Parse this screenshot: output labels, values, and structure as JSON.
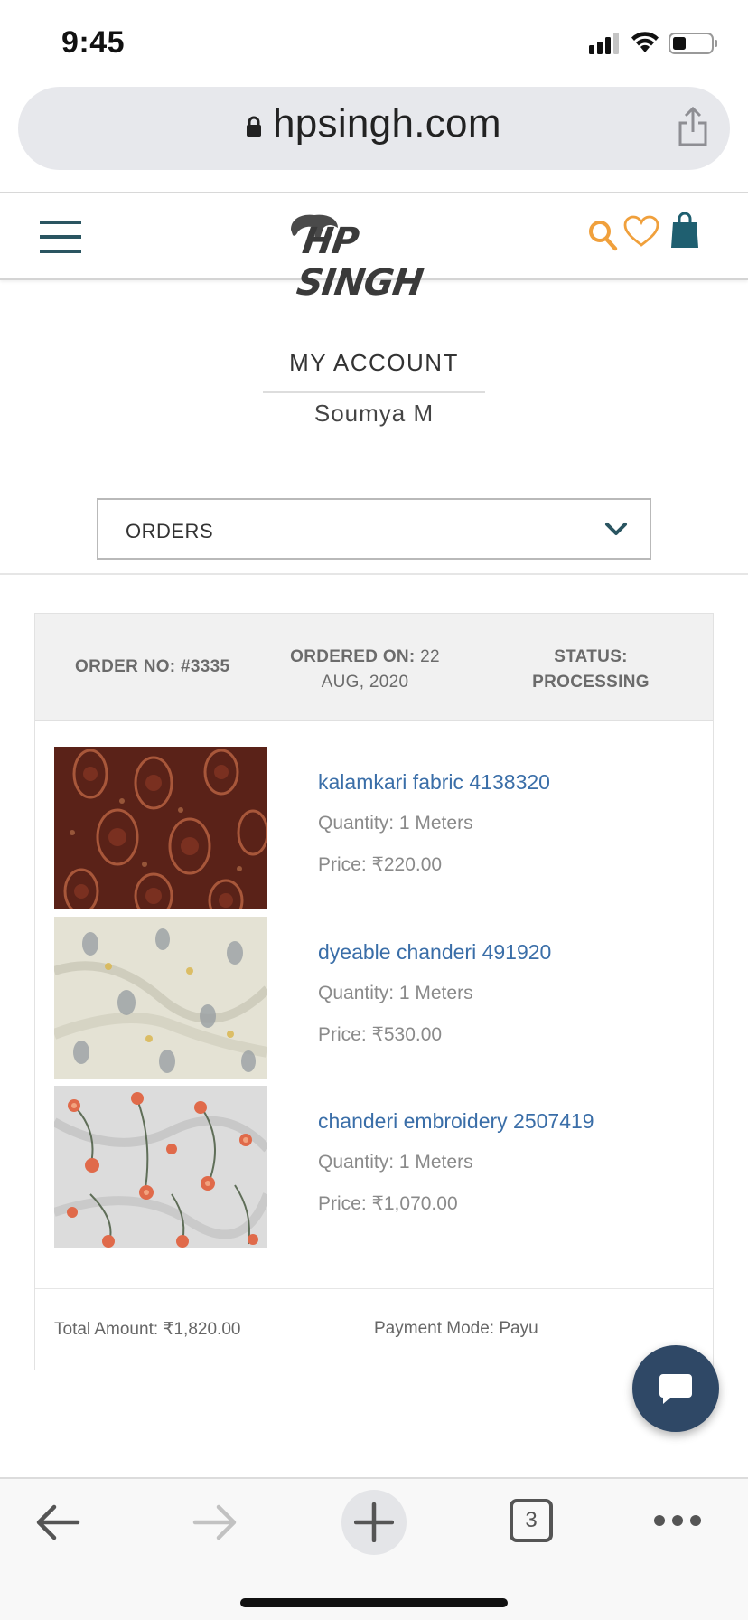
{
  "status_bar": {
    "time": "9:45",
    "icons": [
      "signal-icon",
      "wifi-icon",
      "battery-icon"
    ]
  },
  "browser": {
    "url": "hpsingh.com",
    "icons": [
      "lock-icon",
      "share-icon"
    ]
  },
  "header": {
    "logo_text": "HP SINGH",
    "icons": [
      "menu-icon",
      "search-icon",
      "heart-icon",
      "bag-icon"
    ],
    "accent_color": "#f0a03c",
    "brand_color": "#2a5561"
  },
  "account": {
    "title": "MY ACCOUNT",
    "name": "Soumya M"
  },
  "section_select": {
    "value": "ORDERS"
  },
  "order": {
    "number_label": "ORDER NO: #3335",
    "date_label": "ORDERED ON:",
    "date_value": "22 AUG, 2020",
    "status_label": "STATUS:",
    "status_value": "PROCESSING",
    "items": [
      {
        "name": "kalamkari fabric 4138320",
        "quantity": "Quantity: 1 Meters",
        "price": "Price: ₹220.00"
      },
      {
        "name": "dyeable chanderi 491920",
        "quantity": "Quantity: 1 Meters",
        "price": "Price: ₹530.00"
      },
      {
        "name": "chanderi embroidery 2507419",
        "quantity": "Quantity: 1 Meters",
        "price": "Price: ₹1,070.00"
      }
    ],
    "total_amount": "Total Amount: ₹1,820.00",
    "payment_mode": "Payment Mode: Payu"
  },
  "chat": {
    "icon": "chat-bubble-icon",
    "color": "#2f4866"
  },
  "toolbar": {
    "tab_count": "3",
    "icons": [
      "back-arrow-icon",
      "forward-arrow-icon",
      "plus-icon",
      "tabs-icon",
      "more-icon"
    ]
  }
}
